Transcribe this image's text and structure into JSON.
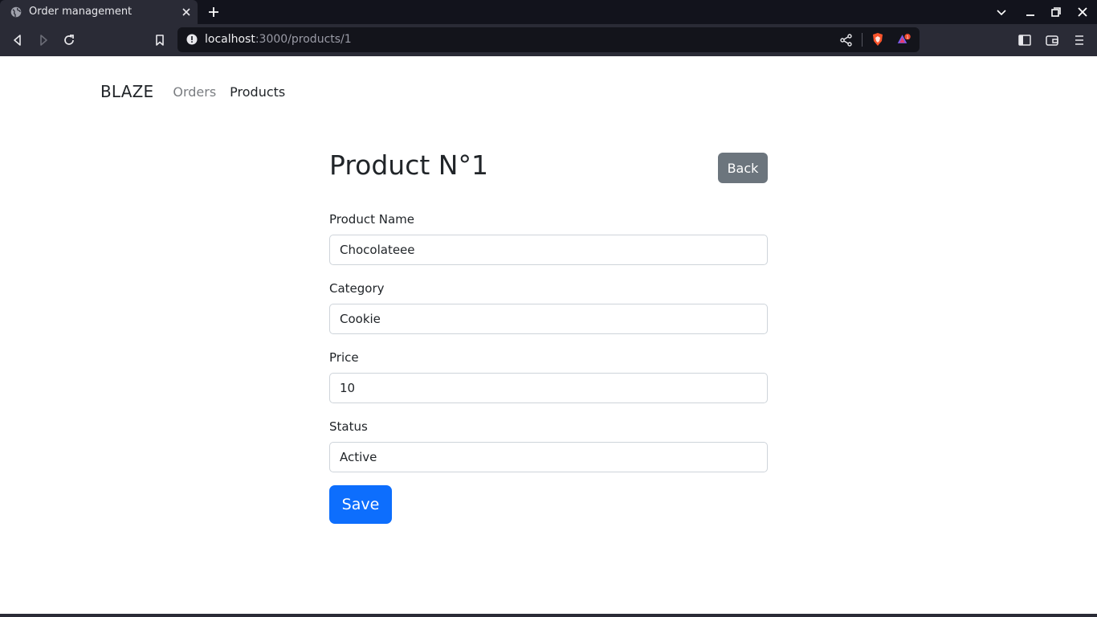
{
  "browser": {
    "tab_title": "Order management",
    "url_host": "localhost",
    "url_path": ":3000/products/1",
    "icons": [
      "globe-icon",
      "close-icon",
      "plus-icon",
      "chevron-down-icon",
      "minimize-icon",
      "maximize-icon",
      "back-icon",
      "forward-icon",
      "reload-icon",
      "bookmark-icon",
      "info-icon",
      "share-icon",
      "brave-shield-icon",
      "brave-rewards-icon",
      "sidebar-icon",
      "wallet-icon",
      "menu-icon"
    ],
    "rewards_badge": "1"
  },
  "navbar": {
    "brand": "BLAZE",
    "links": [
      {
        "label": "Orders",
        "active": false
      },
      {
        "label": "Products",
        "active": true
      }
    ]
  },
  "main": {
    "title": "Product N°1",
    "back_label": "Back",
    "fields": [
      {
        "label": "Product Name",
        "value": "Chocolateee"
      },
      {
        "label": "Category",
        "value": "Cookie"
      },
      {
        "label": "Price",
        "value": "10"
      },
      {
        "label": "Status",
        "value": "Active"
      }
    ],
    "save_label": "Save"
  },
  "colors": {
    "primary": "#0d6efd",
    "secondary": "#6c757d",
    "chrome_dark": "#12131c",
    "chrome": "#2a2b36"
  }
}
